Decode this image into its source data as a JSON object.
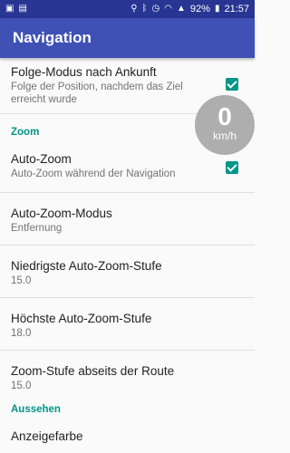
{
  "status_bar": {
    "battery": "92%",
    "time": "21:57",
    "icons": [
      "photo-icon",
      "image-icon",
      "location-icon",
      "bluetooth-icon",
      "alarm-icon",
      "wifi-icon",
      "signal-icon",
      "battery-icon"
    ]
  },
  "app_bar": {
    "title": "Navigation"
  },
  "speed": {
    "value": "0",
    "unit": "km/h"
  },
  "preferences": {
    "follow_mode": {
      "title": "Folge-Modus nach Ankunft",
      "summary": "Folge der Position, nachdem das Ziel erreicht wurde",
      "checked": true
    },
    "zoom_category": "Zoom",
    "auto_zoom": {
      "title": "Auto-Zoom",
      "summary": "Auto-Zoom während der Navigation",
      "checked": true
    },
    "auto_zoom_mode": {
      "title": "Auto-Zoom-Modus",
      "summary": "Entfernung"
    },
    "lowest_zoom": {
      "title": "Niedrigste Auto-Zoom-Stufe",
      "summary": "15.0"
    },
    "highest_zoom": {
      "title": "Höchste Auto-Zoom-Stufe",
      "summary": "18.0"
    },
    "offroute_zoom": {
      "title": "Zoom-Stufe abseits der Route",
      "summary": "15.0"
    },
    "display_category": "Aussehen",
    "display_color": {
      "title": "Anzeigefarbe"
    }
  },
  "colors": {
    "app_bar": "#3f51b5",
    "status_bar": "#283593",
    "accent": "#009688"
  }
}
